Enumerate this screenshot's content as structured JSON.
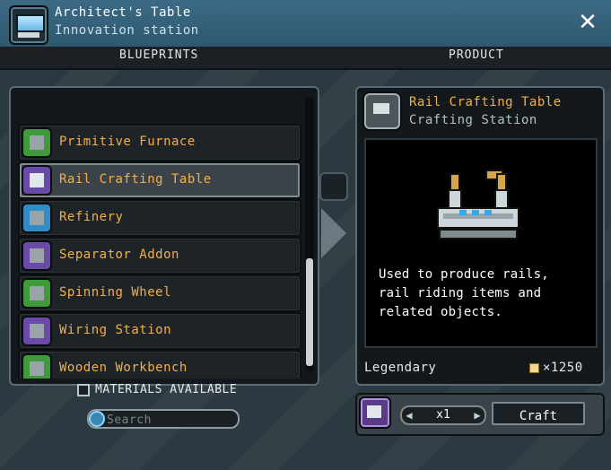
{
  "window": {
    "title": "Architect's Table",
    "subtitle": "Innovation station",
    "close_glyph": "✕"
  },
  "columns": {
    "left": "BLUEPRINTS",
    "right": "PRODUCT"
  },
  "blueprints": [
    {
      "label": "Primitive Furnace",
      "icon": "furnace-icon",
      "icon_color": "#3f9a3a"
    },
    {
      "label": "Rail Crafting Table",
      "icon": "rail-table-icon",
      "icon_color": "#6a4aa8",
      "selected": true
    },
    {
      "label": "Refinery",
      "icon": "refinery-icon",
      "icon_color": "#2f8ec6"
    },
    {
      "label": "Separator Addon",
      "icon": "separator-icon",
      "icon_color": "#6a4aa8"
    },
    {
      "label": "Spinning Wheel",
      "icon": "spinning-wheel-icon",
      "icon_color": "#3f9a3a"
    },
    {
      "label": "Wiring Station",
      "icon": "wiring-station-icon",
      "icon_color": "#6a4aa8"
    },
    {
      "label": "Wooden Workbench",
      "icon": "workbench-icon",
      "icon_color": "#3f9a3a"
    }
  ],
  "filters": {
    "materials_available_label": "MATERIALS AVAILABLE",
    "search_placeholder": "Search"
  },
  "product": {
    "name": "Rail Crafting Table",
    "type": "Crafting Station",
    "description": "Used to produce rails, rail riding items and related objects.",
    "rarity": "Legendary",
    "price": "×1250"
  },
  "craft": {
    "quantity": "x1",
    "button_label": "Craft"
  }
}
